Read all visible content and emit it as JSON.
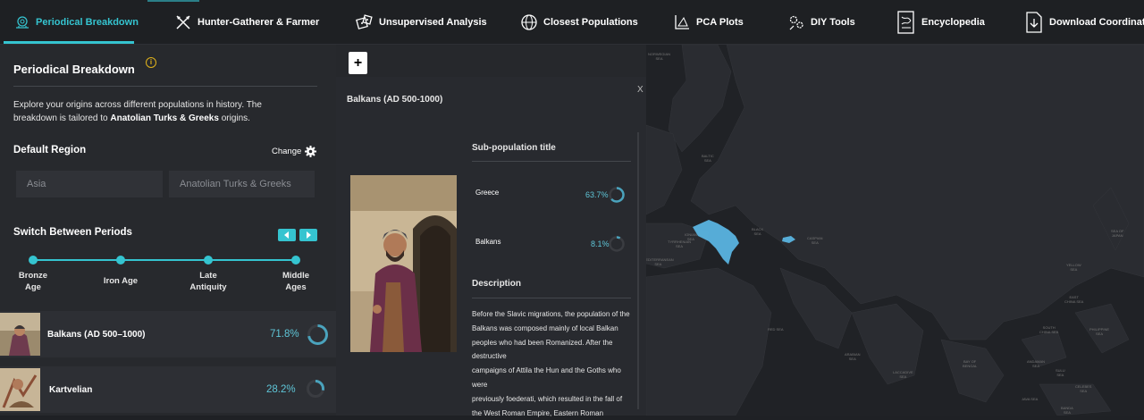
{
  "nav": {
    "items": [
      {
        "label": "Periodical Breakdown",
        "icon": "dna-icon",
        "active": true
      },
      {
        "label": "Hunter-Gatherer & Farmer",
        "icon": "crossed-tools-icon",
        "active": false
      },
      {
        "label": "Unsupervised Analysis",
        "icon": "dice-icon",
        "active": false
      },
      {
        "label": "Closest Populations",
        "icon": "globe-icon",
        "active": false
      },
      {
        "label": "PCA Plots",
        "icon": "plot-icon",
        "active": false
      },
      {
        "label": "DIY Tools",
        "icon": "gears-icon",
        "active": false
      },
      {
        "label": "Encyclopedia",
        "icon": "book-icon",
        "active": false
      },
      {
        "label": "Download Coordinates",
        "icon": "download-file-icon",
        "active": false
      }
    ],
    "accent": "#35c4d0"
  },
  "left_panel": {
    "title": "Periodical Breakdown",
    "info_icon": "i",
    "description_prefix": "Explore your origins across different populations in history. The breakdown is tailored to ",
    "description_bold": "Anatolian Turks & Greeks",
    "description_suffix": " origins.",
    "default_region": {
      "label": "Default Region",
      "change_label": "Change",
      "region_value": "Asia",
      "population_value": "Anatolian Turks & Greeks"
    },
    "periods": {
      "label": "Switch Between Periods",
      "items": [
        {
          "line1": "Bronze",
          "line2": "Age"
        },
        {
          "line1": "Iron Age",
          "line2": ""
        },
        {
          "line1": "Late",
          "line2": "Antiquity"
        },
        {
          "line1": "Middle",
          "line2": "Ages"
        }
      ]
    },
    "populations": [
      {
        "name": "Balkans (AD 500–1000)",
        "percent": "71.8%",
        "value": 0.718
      },
      {
        "name": "Kartvelian",
        "percent": "28.2%",
        "value": 0.282
      }
    ]
  },
  "detail_panel": {
    "close_label": "X",
    "zoom_in_label": "+",
    "title": "Balkans (AD 500-1000)",
    "sub_population_title": "Sub-population title",
    "sub_populations": [
      {
        "name": "Greece",
        "percent": "63.7%",
        "value": 0.637
      },
      {
        "name": "Balkans",
        "percent": "8.1%",
        "value": 0.081
      }
    ],
    "description_title": "Description",
    "description_lines": [
      "Before the Slavic migrations, the population of the",
      "Balkans was composed mainly of local Balkan",
      "peoples who had been Romanized. After the destructive",
      "campaigns of Attila the Hun and the Goths who were",
      "previously foederati, which resulted in the fall of",
      "the West Roman Empire, Eastern Roman"
    ]
  },
  "map": {
    "labels": {
      "norwegian_sea": "NORWEGIAN\nSEA",
      "baltic_sea": "BALTIC\nSEA",
      "mediterranean_sea": "MEDITERRANEAN\nSEA",
      "tyrrhenian_sea": "TYRRHENIAN\nSEA",
      "ionian_sea": "IONIAN\nSEA",
      "black_sea": "BLACK\nSEA",
      "caspian_sea": "CASPIAN\nSEA",
      "red_sea": "RED SEA",
      "arabian_sea": "ARABIAN\nSEA",
      "laccadive_sea": "LACCADIVE\nSEA",
      "bay_of_bengal": "BAY OF\nBENGAL",
      "andaman_sea": "ANDAMAN\nSEA",
      "celebes_sea": "CELEBES\nSEA",
      "java_sea": "JAVA SEA",
      "banda_sea": "BANDA\nSEA",
      "sea_of_japan": "SEA OF\nJAPAN",
      "yellow_sea": "YELLOW\nSEA",
      "east_china_sea": "EAST\nCHINA SEA",
      "philippine_sea": "PHILIPPINE\nSEA",
      "south_china_sea": "SOUTH\nCHINA SEA",
      "sulu_sea": "SULU\nSEA"
    },
    "highlight_color": "#5ab4e0"
  }
}
